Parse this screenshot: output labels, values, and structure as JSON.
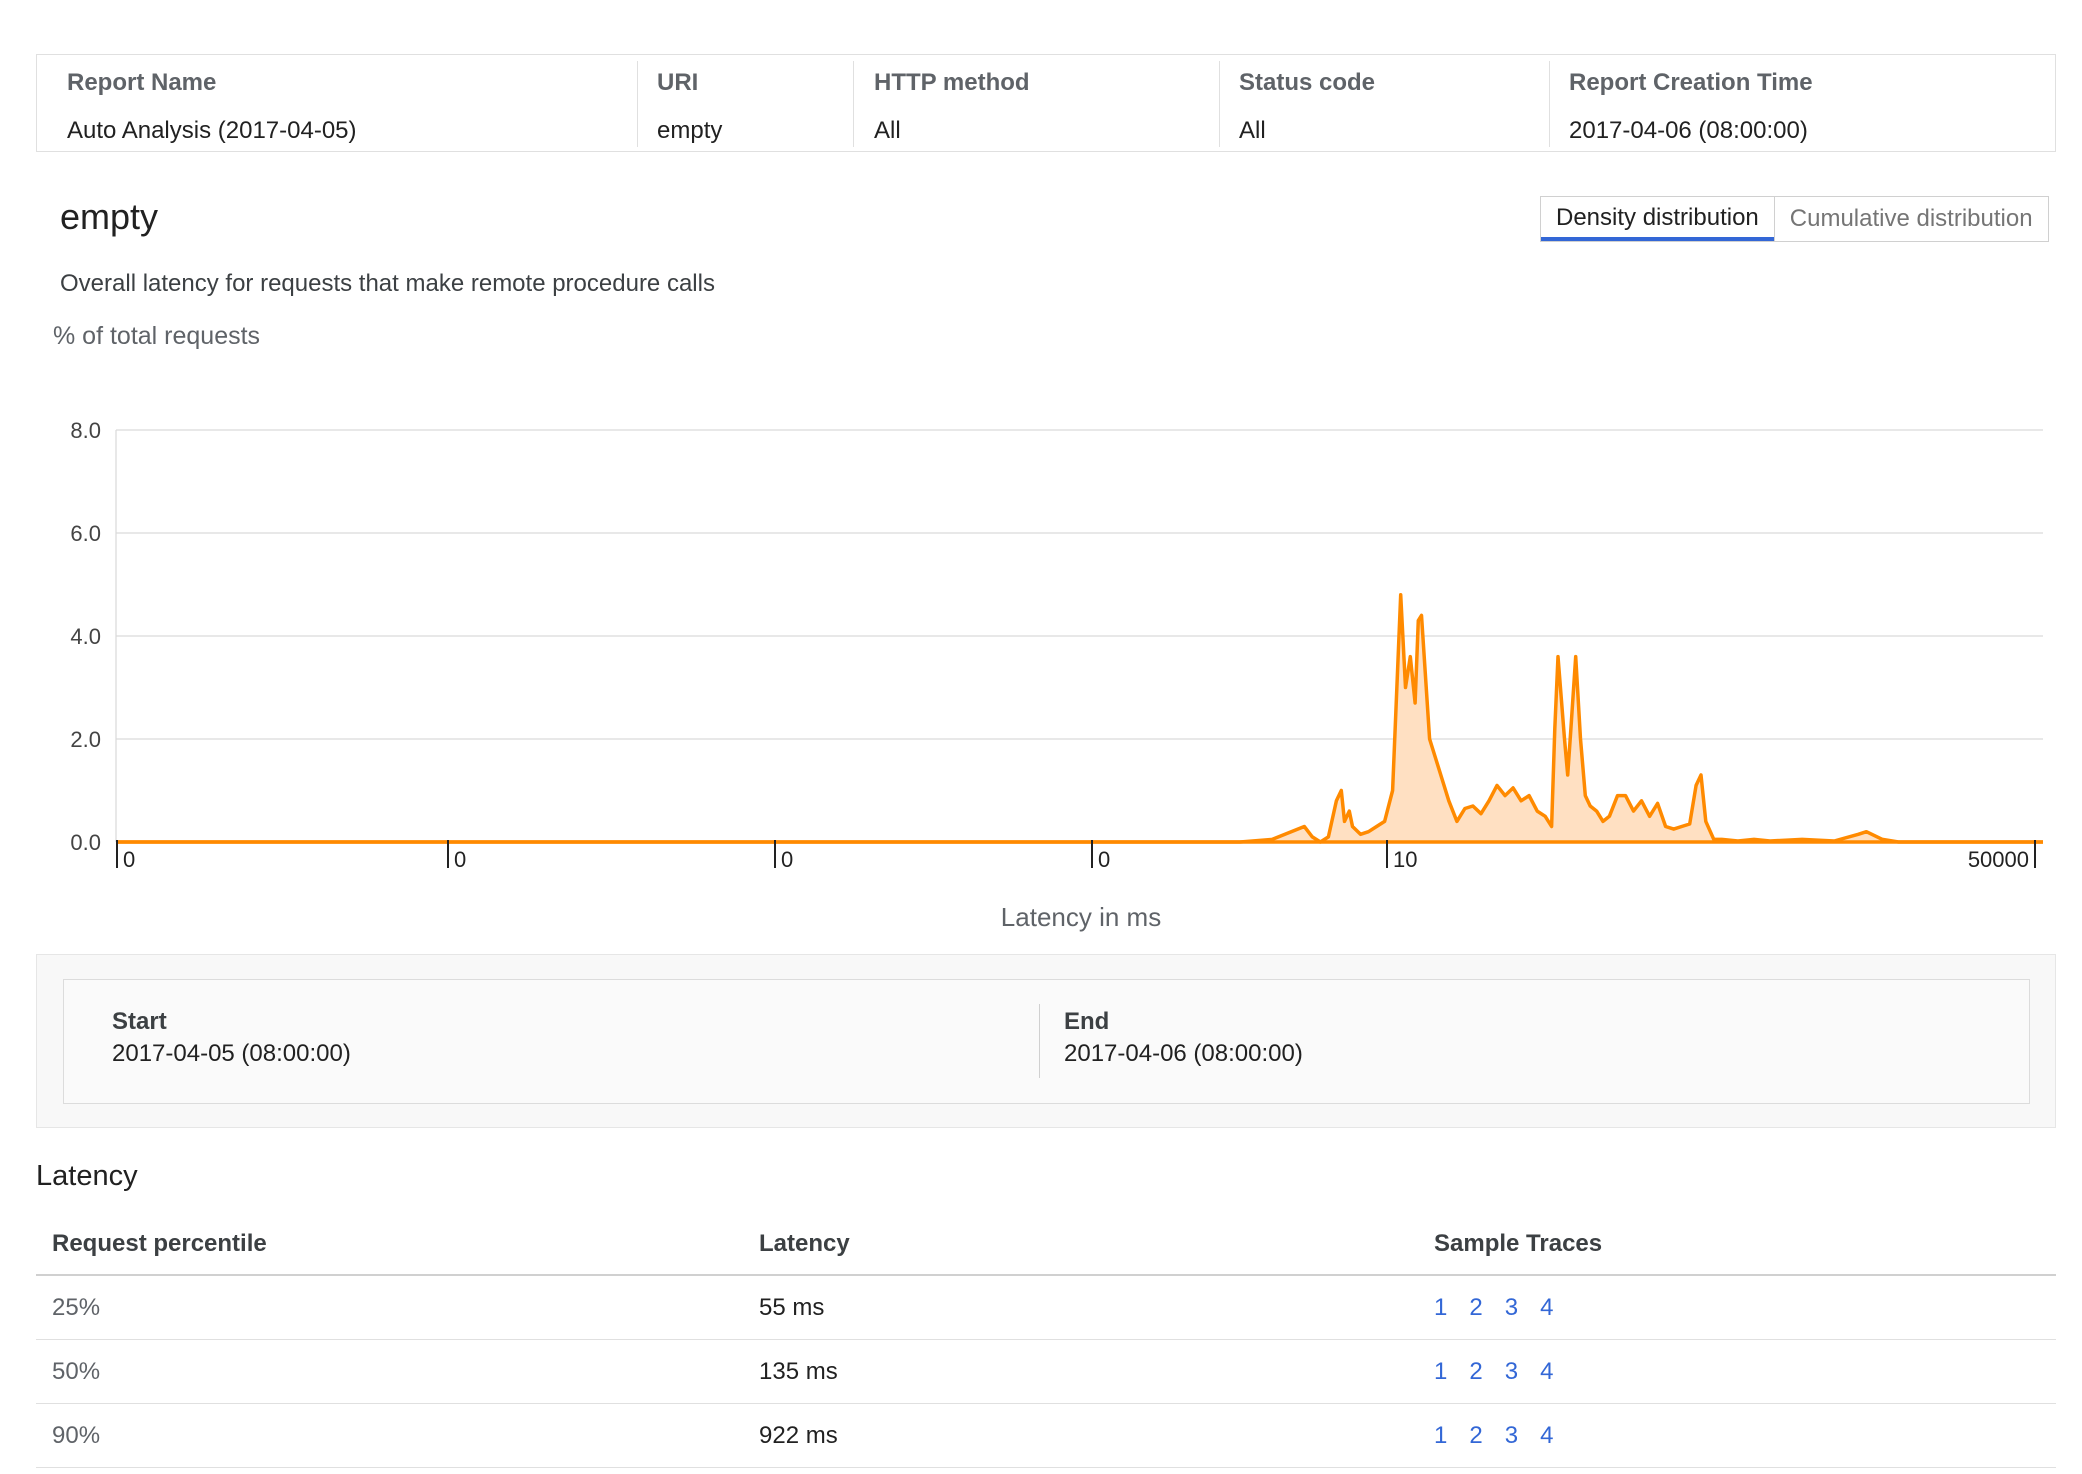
{
  "summary": {
    "columns": [
      {
        "label": "Report Name",
        "value": "Auto Analysis (2017-04-05)"
      },
      {
        "label": "URI",
        "value": "empty"
      },
      {
        "label": "HTTP method",
        "value": "All"
      },
      {
        "label": "Status code",
        "value": "All"
      },
      {
        "label": "Report Creation Time",
        "value": "2017-04-06 (08:00:00)"
      }
    ]
  },
  "report": {
    "title": "empty",
    "subtitle": "Overall latency for requests that make remote procedure calls"
  },
  "tabs": [
    {
      "label": "Density distribution",
      "active": true
    },
    {
      "label": "Cumulative distribution",
      "active": false
    }
  ],
  "chart_data": {
    "type": "area",
    "ylabel": "% of total requests",
    "xlabel": "Latency in ms",
    "ylim": [
      0,
      8
    ],
    "y_ticks": [
      "8.0",
      "6.0",
      "4.0",
      "2.0",
      "0.0"
    ],
    "x_tick_labels": [
      "0",
      "0",
      "0",
      "0",
      "10",
      "50000"
    ],
    "x_scale": "log",
    "grid": true,
    "color": "#ff8a00",
    "fill_color": "#ffe0c2",
    "series": [
      {
        "points": [
          [
            0.0,
            0.0
          ],
          [
            0.7,
            0.0
          ],
          [
            0.72,
            0.05
          ],
          [
            0.74,
            0.3
          ],
          [
            0.745,
            0.1
          ],
          [
            0.75,
            0.0
          ],
          [
            0.755,
            0.1
          ],
          [
            0.76,
            0.8
          ],
          [
            0.763,
            1.0
          ],
          [
            0.765,
            0.4
          ],
          [
            0.768,
            0.6
          ],
          [
            0.77,
            0.3
          ],
          [
            0.775,
            0.15
          ],
          [
            0.78,
            0.2
          ],
          [
            0.785,
            0.3
          ],
          [
            0.79,
            0.4
          ],
          [
            0.795,
            1.0
          ],
          [
            0.8,
            4.8
          ],
          [
            0.803,
            3.0
          ],
          [
            0.806,
            3.6
          ],
          [
            0.809,
            2.7
          ],
          [
            0.811,
            4.3
          ],
          [
            0.813,
            4.4
          ],
          [
            0.818,
            2.0
          ],
          [
            0.825,
            1.3
          ],
          [
            0.83,
            0.8
          ],
          [
            0.835,
            0.4
          ],
          [
            0.84,
            0.65
          ],
          [
            0.845,
            0.7
          ],
          [
            0.85,
            0.55
          ],
          [
            0.855,
            0.8
          ],
          [
            0.86,
            1.1
          ],
          [
            0.865,
            0.9
          ],
          [
            0.87,
            1.05
          ],
          [
            0.875,
            0.8
          ],
          [
            0.88,
            0.9
          ],
          [
            0.885,
            0.6
          ],
          [
            0.89,
            0.5
          ],
          [
            0.894,
            0.3
          ],
          [
            0.896,
            2.2
          ],
          [
            0.898,
            3.6
          ],
          [
            0.902,
            2.0
          ],
          [
            0.904,
            1.3
          ],
          [
            0.906,
            2.2
          ],
          [
            0.909,
            3.6
          ],
          [
            0.912,
            2.0
          ],
          [
            0.915,
            0.9
          ],
          [
            0.918,
            0.7
          ],
          [
            0.922,
            0.6
          ],
          [
            0.926,
            0.4
          ],
          [
            0.93,
            0.5
          ],
          [
            0.935,
            0.9
          ],
          [
            0.94,
            0.9
          ],
          [
            0.945,
            0.6
          ],
          [
            0.95,
            0.8
          ],
          [
            0.955,
            0.5
          ],
          [
            0.96,
            0.75
          ],
          [
            0.965,
            0.3
          ],
          [
            0.97,
            0.25
          ],
          [
            0.975,
            0.3
          ],
          [
            0.98,
            0.35
          ],
          [
            0.984,
            1.1
          ],
          [
            0.987,
            1.3
          ],
          [
            0.99,
            0.4
          ],
          [
            0.995,
            0.05
          ],
          [
            1.0,
            0.05
          ],
          [
            1.01,
            0.02
          ],
          [
            1.02,
            0.05
          ],
          [
            1.03,
            0.02
          ],
          [
            1.05,
            0.05
          ],
          [
            1.07,
            0.02
          ],
          [
            1.085,
            0.15
          ],
          [
            1.09,
            0.2
          ],
          [
            1.1,
            0.05
          ],
          [
            1.11,
            0.0
          ],
          [
            1.2,
            0.0
          ]
        ]
      }
    ]
  },
  "range": {
    "start_label": "Start",
    "start_value": "2017-04-05 (08:00:00)",
    "end_label": "End",
    "end_value": "2017-04-06 (08:00:00)"
  },
  "latency": {
    "title": "Latency",
    "headers": [
      "Request percentile",
      "Latency",
      "Sample Traces"
    ],
    "rows": [
      {
        "percentile": "25%",
        "latency": "55 ms",
        "traces": [
          "1",
          "2",
          "3",
          "4"
        ]
      },
      {
        "percentile": "50%",
        "latency": "135 ms",
        "traces": [
          "1",
          "2",
          "3",
          "4"
        ]
      },
      {
        "percentile": "90%",
        "latency": "922 ms",
        "traces": [
          "1",
          "2",
          "3",
          "4"
        ]
      }
    ]
  }
}
